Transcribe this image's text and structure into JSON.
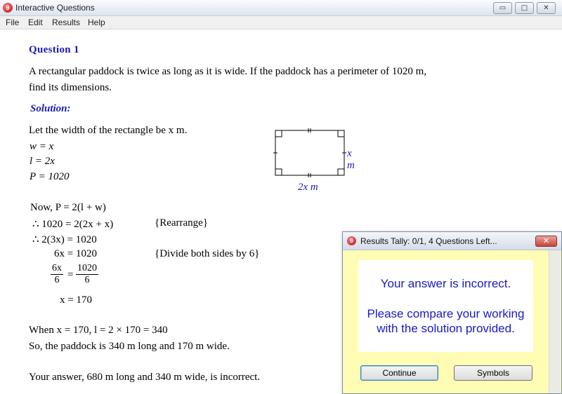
{
  "window": {
    "title": "Interactive Questions",
    "icon": "app-logo-icon",
    "icon_glyph": "9"
  },
  "menu": {
    "file": "File",
    "edit": "Edit",
    "results": "Results",
    "help": "Help"
  },
  "question": {
    "title": "Question 1",
    "text_line1": "A rectangular paddock is twice as long as it is wide.  If the paddock has a perimeter of 1020 m,",
    "text_line2": "find its dimensions."
  },
  "solution": {
    "title": "Solution:",
    "lines": {
      "let": "Let the width of the rectangle be x m.",
      "w": "w = x",
      "l": "l = 2x",
      "p": "P = 1020",
      "now": "Now, P = 2(l + w)",
      "sub": "∴ 1020 = 2(2x + x)",
      "sub_note": "{Rearrange}",
      "simp": "∴ 2(3x) = 1020",
      "six": "6x = 1020",
      "six_note": "{Divide both sides by 6}",
      "frac_left_num": "6x",
      "frac_left_den": "6",
      "frac_eq": "=",
      "frac_right_num": "1020",
      "frac_right_den": "6",
      "x": "x = 170",
      "when": "When x = 170, l = 2 × 170 = 340",
      "so": "So, the paddock is 340 m long and 170 m wide."
    },
    "diagram": {
      "side_label": "x m",
      "bottom_label": "2x m"
    },
    "your_answer": "Your answer, 680 m long and 340 m wide, is incorrect."
  },
  "dialog": {
    "title": "Results Tally:  0/1, 4 Questions Left...",
    "close": "✕",
    "message1": "Your answer is incorrect.",
    "message2_line1": "Please compare your working",
    "message2_line2": "with the solution provided.",
    "continue_label": "Continue",
    "symbols_label": "Symbols"
  },
  "colors": {
    "heading_blue": "#1b1bb0",
    "message_blue": "#1919c8",
    "dialog_bg": "#fffdb4"
  }
}
